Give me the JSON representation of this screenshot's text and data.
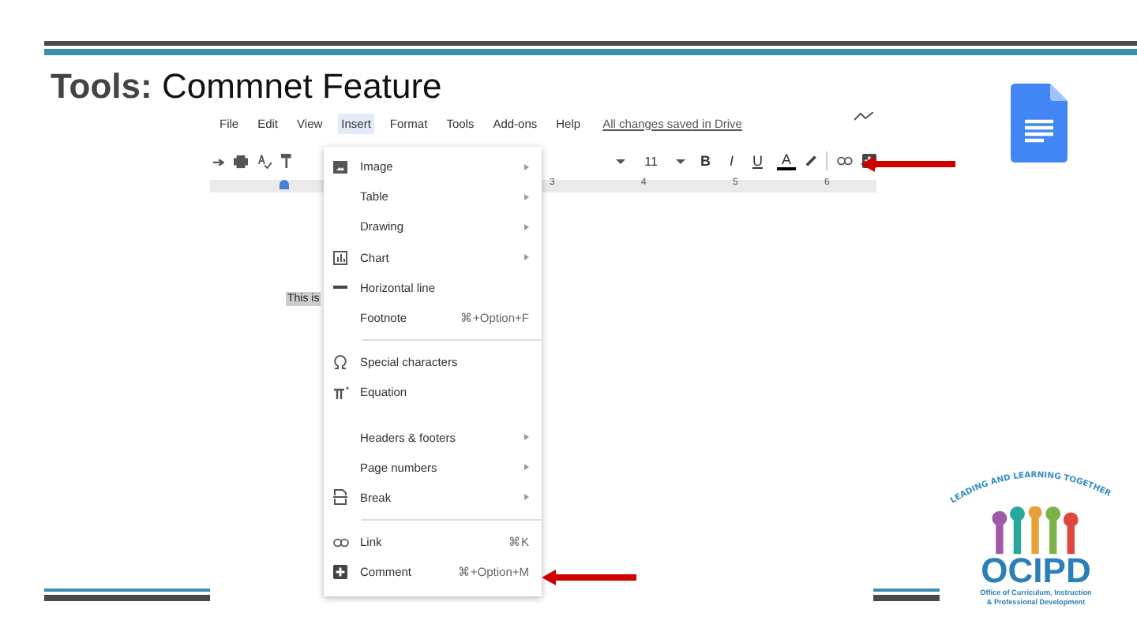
{
  "slide": {
    "title_bold": "Tools:",
    "title_rest": "Commnet Feature"
  },
  "docs": {
    "menubar": [
      {
        "label": "File",
        "selected": false
      },
      {
        "label": "Edit",
        "selected": false
      },
      {
        "label": "View",
        "selected": false
      },
      {
        "label": "Insert",
        "selected": true
      },
      {
        "label": "Format",
        "selected": false
      },
      {
        "label": "Tools",
        "selected": false
      },
      {
        "label": "Add-ons",
        "selected": false
      },
      {
        "label": "Help",
        "selected": false
      }
    ],
    "save_status": "All changes saved in Drive",
    "font_size": "11",
    "format_buttons": [
      "B",
      "I",
      "U",
      "A"
    ],
    "ruler_numbers": [
      "3",
      "4",
      "5",
      "6"
    ],
    "document_text": "This is",
    "insert_menu": [
      [
        {
          "label": "Image",
          "submenu": true
        },
        {
          "label": "Table",
          "submenu": true
        },
        {
          "label": "Drawing",
          "submenu": true
        },
        {
          "label": "Chart",
          "submenu": true
        },
        {
          "label": "Horizontal line",
          "submenu": false
        },
        {
          "label": "Footnote",
          "shortcut": "⌘+Option+F",
          "submenu": false
        }
      ],
      [
        {
          "label": "Special characters",
          "submenu": false
        },
        {
          "label": "Equation",
          "submenu": false
        }
      ],
      [
        {
          "label": "Headers & footers",
          "submenu": true
        },
        {
          "label": "Page numbers",
          "submenu": true
        },
        {
          "label": "Break",
          "submenu": true
        }
      ],
      [
        {
          "label": "Link",
          "shortcut": "⌘K",
          "submenu": false
        },
        {
          "label": "Comment",
          "shortcut": "⌘+Option+M",
          "submenu": false
        }
      ]
    ]
  },
  "logo": {
    "motto": "LEADING AND LEARNING TOGETHER",
    "acronym": "OCIPD",
    "lines": [
      "Office of Curriculum, Instruction",
      "& Professional Development"
    ]
  }
}
